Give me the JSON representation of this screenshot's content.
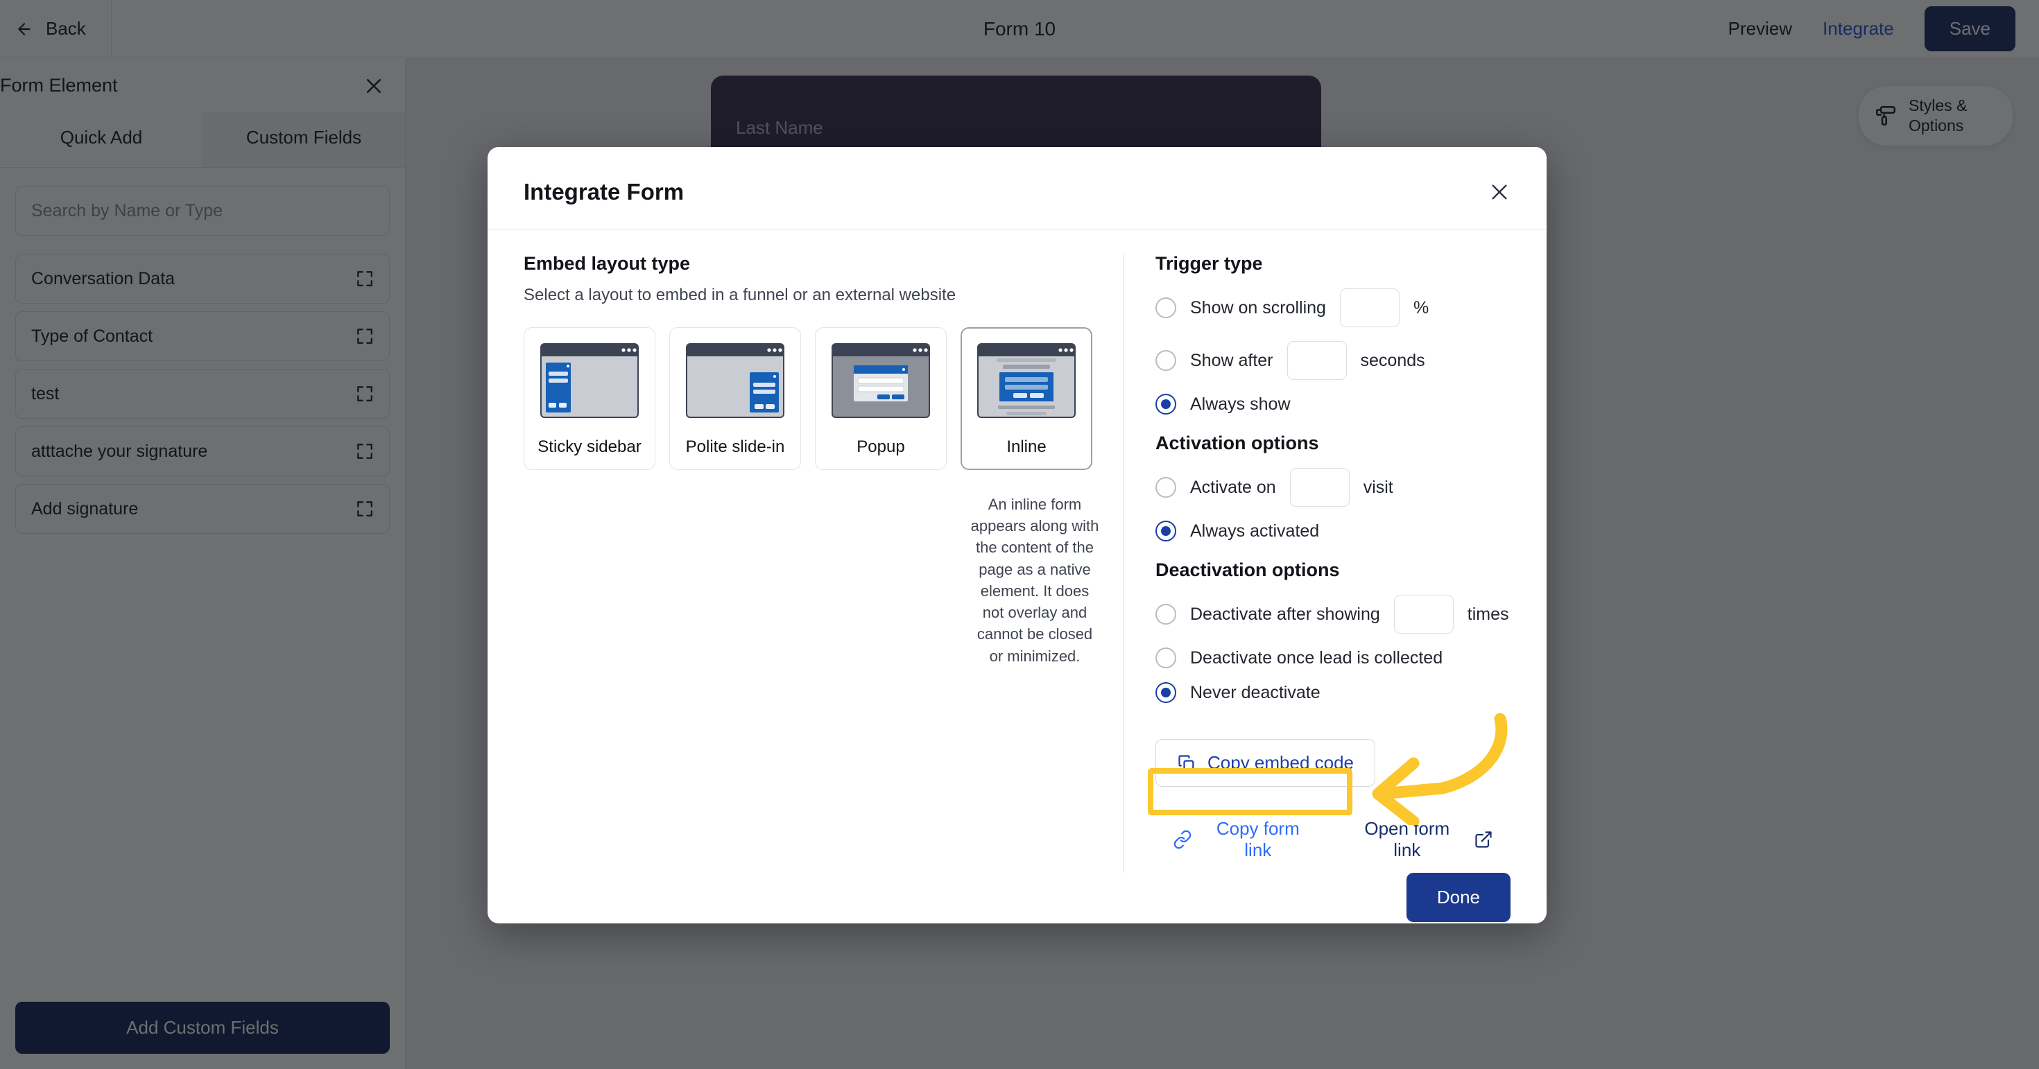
{
  "topbar": {
    "back_label": "Back",
    "back_icon": "arrow-left-icon",
    "form_title": "Form 10",
    "preview_label": "Preview",
    "integrate_label": "Integrate",
    "save_label": "Save"
  },
  "sidebar": {
    "title": "Form Element",
    "close_icon": "close-icon",
    "tabs": [
      {
        "label": "Quick Add",
        "active": false
      },
      {
        "label": "Custom Fields",
        "active": true
      }
    ],
    "search": {
      "placeholder": "Search by Name or Type",
      "value": ""
    },
    "items": [
      {
        "label": "Conversation Data",
        "icon": "expand-icon"
      },
      {
        "label": "Type of Contact",
        "icon": "expand-icon"
      },
      {
        "label": "test",
        "icon": "expand-icon"
      },
      {
        "label": "atttache your signature",
        "icon": "expand-icon"
      },
      {
        "label": "Add signature",
        "icon": "expand-icon"
      }
    ],
    "footer_button": "Add Custom Fields"
  },
  "canvas": {
    "styles_button": {
      "label": "Styles & Options",
      "icon": "paint-roller-icon"
    },
    "form_preview": {
      "field_label": "Last Name"
    }
  },
  "modal": {
    "title": "Integrate Form",
    "close_icon": "close-icon",
    "embed": {
      "heading": "Embed layout type",
      "subheading": "Select a layout to embed in a funnel or an external website",
      "options": [
        {
          "label": "Sticky sidebar",
          "selected": false
        },
        {
          "label": "Polite slide-in",
          "selected": false
        },
        {
          "label": "Popup",
          "selected": false
        },
        {
          "label": "Inline",
          "selected": true
        }
      ],
      "selected_description": "An inline form appears along with the content of the page as a native element. It does not overlay and cannot be closed or minimized."
    },
    "trigger": {
      "heading": "Trigger type",
      "options": [
        {
          "label": "Show on scrolling",
          "checked": false,
          "input_value": "",
          "unit": "%"
        },
        {
          "label": "Show after",
          "checked": false,
          "input_value": "",
          "unit": "seconds"
        },
        {
          "label": "Always show",
          "checked": true
        }
      ]
    },
    "activation": {
      "heading": "Activation options",
      "options": [
        {
          "label": "Activate on",
          "checked": false,
          "input_value": "",
          "unit": "visit"
        },
        {
          "label": "Always activated",
          "checked": true
        }
      ]
    },
    "deactivation": {
      "heading": "Deactivation options",
      "options": [
        {
          "label": "Deactivate after showing",
          "checked": false,
          "input_value": "",
          "unit": "times"
        },
        {
          "label": "Deactivate once lead is collected",
          "checked": false
        },
        {
          "label": "Never deactivate",
          "checked": true
        }
      ]
    },
    "actions": {
      "copy_embed_code": "Copy embed code",
      "copy_embed_icon": "copy-icon",
      "copy_form_link": "Copy form link",
      "copy_link_icon": "link-icon",
      "open_form_link": "Open form link",
      "open_link_icon": "external-link-icon",
      "done": "Done"
    }
  },
  "annotations": {
    "highlight_color": "#fcc72c",
    "highlight_target": "Copy form link",
    "arrow": "curved-arrow-pointing-left"
  }
}
